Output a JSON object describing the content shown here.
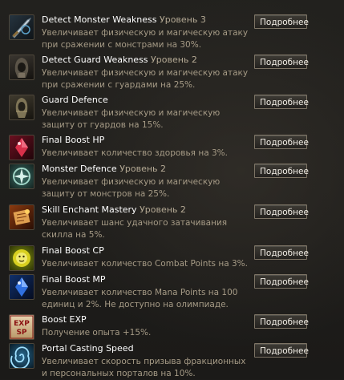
{
  "more_label": "Подробнее",
  "skills": [
    {
      "name": "Detect Monster Weakness",
      "level": "Уровень 3",
      "desc": "Увеличивает физическую и магическую атаку при сражении с монстрами на 30%.",
      "icon": "sword-icon"
    },
    {
      "name": "Detect Guard Weakness",
      "level": "Уровень 2",
      "desc": "Увеличивает физическую и магическую атаку при сражении с гуардами на 25%.",
      "icon": "guard-hood-icon"
    },
    {
      "name": "Guard Defence",
      "level": "",
      "desc": "Увеличивает физическую и магическую защиту от гуардов на 15%.",
      "icon": "shield-guard-icon"
    },
    {
      "name": "Final Boost HP",
      "level": "",
      "desc": "Увеличивает количество здоровья на 3%.",
      "icon": "hp-crystal-icon"
    },
    {
      "name": "Monster Defence",
      "level": "Уровень 2",
      "desc": "Увеличивает физическую и магическую защиту от монстров на 25%.",
      "icon": "monster-defence-icon"
    },
    {
      "name": "Skill Enchant Mastery",
      "level": "Уровень 2",
      "desc": "Увеличивает шанс удачного затачивания скилла на 5%.",
      "icon": "enchant-scroll-icon"
    },
    {
      "name": "Final Boost CP",
      "level": "",
      "desc": "Увеличивает количество Combat Points на 3%.",
      "icon": "cp-lion-icon"
    },
    {
      "name": "Final Boost MP",
      "level": "",
      "desc": "Увеличивает количество Mana Points на 100 единиц и 2%. Не доступно на олимпиаде.",
      "icon": "mp-crystal-icon"
    },
    {
      "name": "Boost EXP",
      "level": "",
      "desc": "Получение опыта +15%.",
      "icon": "exp-sp-icon",
      "icon_text_1": "EXP",
      "icon_text_2": "SP"
    },
    {
      "name": "Portal Casting Speed",
      "level": "",
      "desc": "Увеличивает скорость призыва фракционных и персональных порталов на 10%.",
      "icon": "portal-swirl-icon"
    }
  ]
}
